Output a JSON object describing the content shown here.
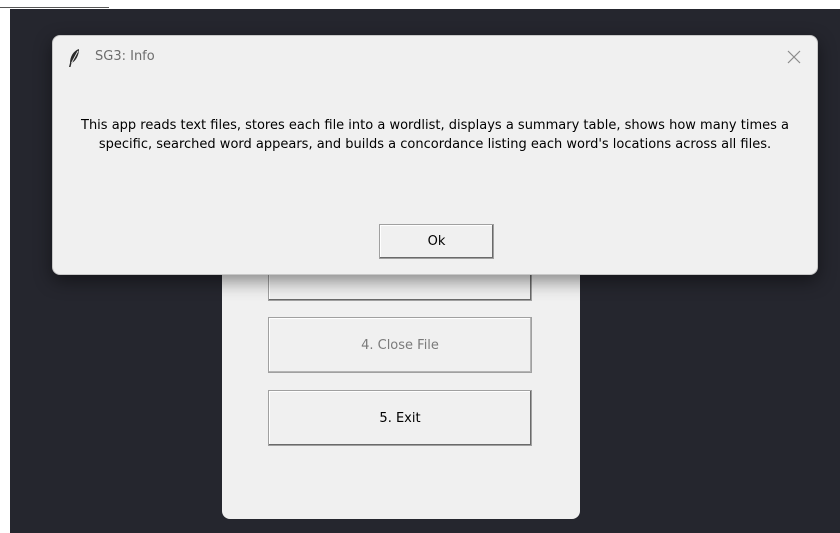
{
  "dialog": {
    "title": "SG3: Info",
    "message": "This app reads text files, stores each file into a wordlist, displays a summary table, shows how many times a specific, searched word appears, and builds a concordance listing each word's locations across all files.",
    "ok_label": "Ok",
    "icons": {
      "app": "feather-icon",
      "close": "close-icon"
    }
  },
  "main_window": {
    "buttons": [
      {
        "label": "",
        "enabled": true
      },
      {
        "label": "4. Close File",
        "enabled": false
      },
      {
        "label": "5. Exit",
        "enabled": true
      }
    ]
  },
  "colors": {
    "desktop": "#25262e",
    "window": "#f0f0f0",
    "title_text": "#6d6d6d",
    "disabled_text": "#7a7a7a"
  }
}
